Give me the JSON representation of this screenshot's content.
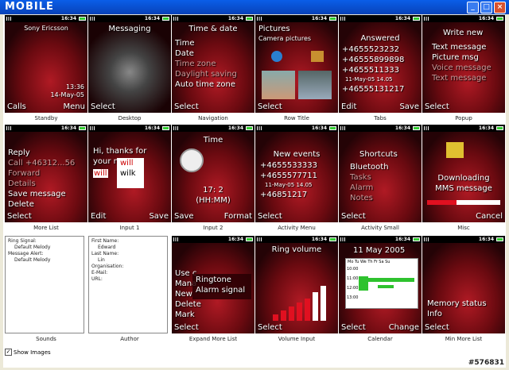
{
  "window": {
    "logo": "MOBILE",
    "min": "_",
    "max": "□",
    "close": "×"
  },
  "statusbar_time": "16:34",
  "cells": [
    {
      "id": "standby",
      "caption": "Standby",
      "lines": [
        "Sony Ericsson",
        "13:36",
        "14-May-05"
      ],
      "left": "Calls",
      "right": "Menu"
    },
    {
      "id": "desktop",
      "caption": "Desktop",
      "lines": [
        "Messaging"
      ],
      "left": "Select",
      "right": ""
    },
    {
      "id": "navigation",
      "caption": "Navigation",
      "lines": [
        "Time & date",
        "Time",
        "Date",
        "Time zone",
        "Daylight saving",
        "Auto time zone"
      ],
      "left": "Select",
      "right": ""
    },
    {
      "id": "row-title",
      "caption": "Row Title",
      "lines": [
        "Pictures",
        "Camera pictures"
      ],
      "left": "Select",
      "right": ""
    },
    {
      "id": "tabs",
      "caption": "Tabs",
      "lines": [
        "Answered",
        "+4655523232",
        "+46555899898",
        "+4655511333",
        "11-May-05   14.05",
        "+46555131217"
      ],
      "left": "Edit",
      "right": "Save"
    },
    {
      "id": "popup",
      "caption": "Popup",
      "lines": [
        "Write new",
        "Text message",
        "Picture msg",
        "Voice message",
        "Text message"
      ],
      "left": "Select",
      "right": ""
    },
    {
      "id": "more-list",
      "caption": "More List",
      "lines": [
        "Reply",
        "Call +46312...56",
        "Forward",
        "Details",
        "Save message",
        "Delete"
      ],
      "left": "Select",
      "right": ""
    },
    {
      "id": "input-1",
      "caption": "Input 1",
      "lines": [
        "Hi, thanks for",
        "your m",
        "will",
        "wilk",
        "will"
      ],
      "left": "Edit",
      "right": "Save"
    },
    {
      "id": "input-2",
      "caption": "Input 2",
      "lines": [
        "Time",
        "17: 2",
        "(HH:MM)"
      ],
      "left": "Save",
      "right": "Format"
    },
    {
      "id": "activity-menu",
      "caption": "Activity Menu",
      "lines": [
        "New events",
        "+4655533333",
        "+4655577711",
        "11-May-05   14.05",
        "+46851217"
      ],
      "left": "Select",
      "right": ""
    },
    {
      "id": "activity-small",
      "caption": "Activity Small",
      "lines": [
        "Shortcuts",
        "Bluetooth",
        "Tasks",
        "Alarm",
        "Notes"
      ],
      "left": "Select",
      "right": ""
    },
    {
      "id": "misc",
      "caption": "Misc",
      "lines": [
        "Downloading",
        "MMS message"
      ],
      "left": "",
      "right": "Cancel"
    },
    {
      "id": "expand-more-list",
      "caption": "Expand More List",
      "lines": [
        "Use c",
        "Mana",
        "New",
        "Delete",
        "Mark",
        "Ringtone",
        "Alarm signal"
      ],
      "left": "Select",
      "right": ""
    },
    {
      "id": "volume-input",
      "caption": "Volume Input",
      "lines": [
        "Ring volume"
      ],
      "left": "Select",
      "right": ""
    },
    {
      "id": "calendar",
      "caption": "Calendar",
      "lines": [
        "11 May 2005",
        "Mo Tu We Th Fr Sa Su",
        "10:00",
        "11:00",
        "12:00",
        "13:00"
      ],
      "left": "Select",
      "right": "Change"
    },
    {
      "id": "min-more-list",
      "caption": "Min More List",
      "lines": [
        "Memory status",
        "Info"
      ],
      "left": "Select",
      "right": ""
    }
  ],
  "sounds": {
    "caption": "Sounds",
    "lines": [
      "Ring Signal:",
      "Default Melody",
      "Message Alert:",
      "Default Melody"
    ]
  },
  "author": {
    "caption": "Author",
    "lines": [
      "First Name:",
      "Edward",
      "Last Name:",
      "Lin",
      "Organisation:",
      "",
      "E-Mail:",
      "",
      "URL:"
    ]
  },
  "show_images": "Show Images",
  "watermark": "#576831"
}
